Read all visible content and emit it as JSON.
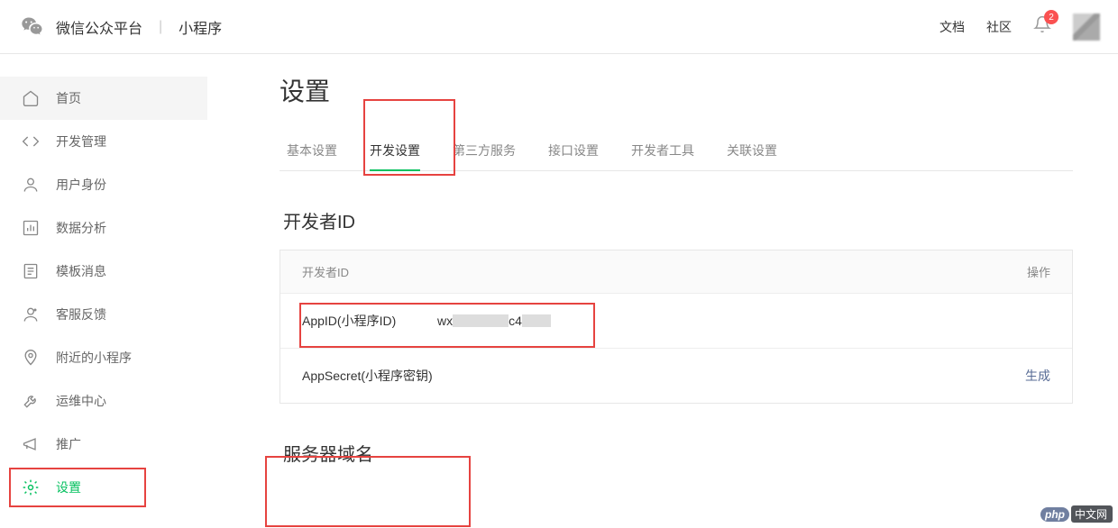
{
  "header": {
    "platform": "微信公众平台",
    "subname": "小程序",
    "links": {
      "docs": "文档",
      "community": "社区"
    },
    "badge": "2"
  },
  "sidebar": {
    "items": [
      {
        "label": "首页",
        "icon": "home"
      },
      {
        "label": "开发管理",
        "icon": "code"
      },
      {
        "label": "用户身份",
        "icon": "user"
      },
      {
        "label": "数据分析",
        "icon": "chart"
      },
      {
        "label": "模板消息",
        "icon": "template"
      },
      {
        "label": "客服反馈",
        "icon": "support"
      },
      {
        "label": "附近的小程序",
        "icon": "location"
      },
      {
        "label": "运维中心",
        "icon": "wrench"
      },
      {
        "label": "推广",
        "icon": "megaphone"
      },
      {
        "label": "设置",
        "icon": "gear"
      }
    ]
  },
  "content": {
    "title": "设置",
    "tabs": [
      "基本设置",
      "开发设置",
      "第三方服务",
      "接口设置",
      "开发者工具",
      "关联设置"
    ],
    "active_tab": "开发设置",
    "dev_id_section": {
      "title": "开发者ID",
      "head_id": "开发者ID",
      "head_action": "操作",
      "rows": [
        {
          "label": "AppID(小程序ID)",
          "value_prefix": "wx",
          "value_mid": "c4",
          "action": ""
        },
        {
          "label": "AppSecret(小程序密钥)",
          "value_prefix": "",
          "value_mid": "",
          "action": "生成"
        }
      ]
    },
    "domain_section": {
      "title": "服务器域名"
    }
  },
  "watermark": {
    "brand": "php",
    "site": "中文网"
  }
}
